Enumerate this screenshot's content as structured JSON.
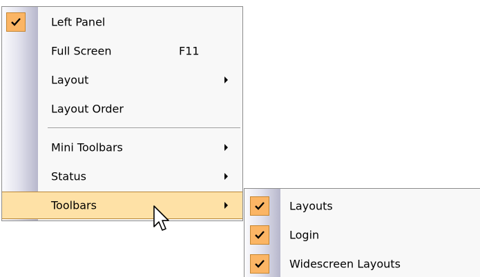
{
  "main_menu": {
    "items": [
      {
        "label": "Left Panel",
        "checked": true
      },
      {
        "label": "Full Screen",
        "shortcut": "F11"
      },
      {
        "label": "Layout",
        "submenu": true
      },
      {
        "label": "Layout Order"
      },
      {
        "label": "Mini Toolbars",
        "submenu": true
      },
      {
        "label": "Status",
        "submenu": true
      },
      {
        "label": "Toolbars",
        "submenu": true,
        "highlighted": true
      }
    ]
  },
  "sub_menu": {
    "items": [
      {
        "label": "Layouts",
        "checked": true
      },
      {
        "label": "Login",
        "checked": true
      },
      {
        "label": "Widescreen Layouts",
        "checked": true
      }
    ]
  },
  "colors": {
    "highlight_bg": "#fee1a6",
    "highlight_border": "#b98636",
    "check_bg": "#fbb565",
    "menu_bg": "#f8f8f8"
  },
  "icons": [
    "checkmark-icon",
    "submenu-arrow-icon",
    "mouse-pointer-icon"
  ]
}
